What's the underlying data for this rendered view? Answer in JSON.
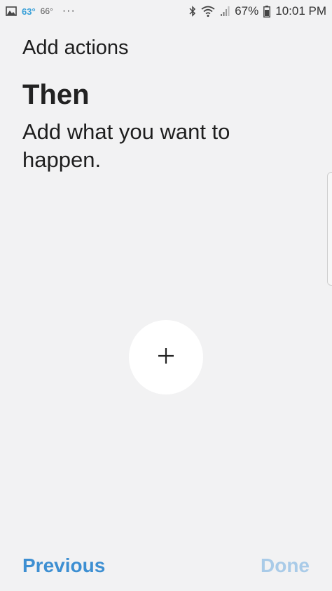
{
  "status_bar": {
    "temp_primary": "63°",
    "temp_secondary": "66°",
    "more": "···",
    "battery": "67%",
    "time": "10:01 PM"
  },
  "icons": {
    "gallery": "image-icon",
    "bluetooth": "bluetooth-icon",
    "wifi": "wifi-icon",
    "signal": "signal-icon",
    "battery": "battery-icon",
    "add": "plus-icon"
  },
  "header": {
    "title": "Add actions"
  },
  "section": {
    "title": "Then",
    "description": "Add what you want to happen."
  },
  "footer": {
    "previous_label": "Previous",
    "done_label": "Done"
  },
  "colors": {
    "accent": "#3d8fd2",
    "disabled_accent": "#a9cbe8",
    "background": "#f2f2f3"
  }
}
